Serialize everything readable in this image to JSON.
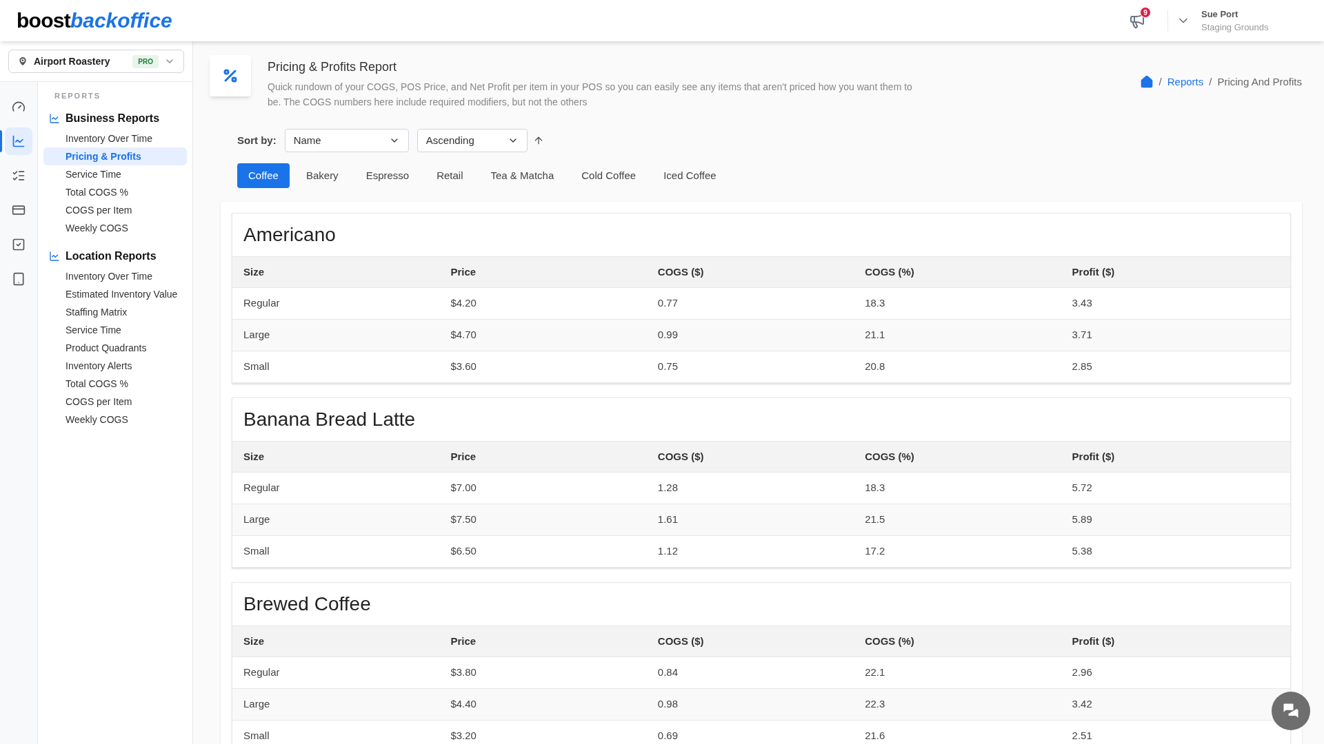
{
  "logo": {
    "part_1": "boost",
    "part_2": "backoffice"
  },
  "header": {
    "notification_count": "9",
    "user_name": "Sue Port",
    "user_location": "Staging Grounds"
  },
  "location_picker": {
    "name": "Airport Roastery",
    "badge": "PRO"
  },
  "rail": [
    {
      "kind": "gauge",
      "selected": false
    },
    {
      "kind": "chart",
      "selected": true
    },
    {
      "kind": "checklist",
      "selected": false
    },
    {
      "kind": "card",
      "selected": false
    },
    {
      "kind": "checkbox",
      "selected": false
    },
    {
      "kind": "tablet",
      "selected": false
    }
  ],
  "sidebar": {
    "section_label": "REPORTS",
    "groups": [
      {
        "title": "Business Reports",
        "items": [
          {
            "label": "Inventory Over Time",
            "selected": false
          },
          {
            "label": "Pricing & Profits",
            "selected": true
          },
          {
            "label": "Service Time",
            "selected": false
          },
          {
            "label": "Total COGS %",
            "selected": false
          },
          {
            "label": "COGS per Item",
            "selected": false
          },
          {
            "label": "Weekly COGS",
            "selected": false
          }
        ]
      },
      {
        "title": "Location Reports",
        "items": [
          {
            "label": "Inventory Over Time",
            "selected": false
          },
          {
            "label": "Estimated Inventory Value",
            "selected": false
          },
          {
            "label": "Staffing Matrix",
            "selected": false
          },
          {
            "label": "Service Time",
            "selected": false
          },
          {
            "label": "Product Quadrants",
            "selected": false
          },
          {
            "label": "Inventory Alerts",
            "selected": false
          },
          {
            "label": "Total COGS %",
            "selected": false
          },
          {
            "label": "COGS per Item",
            "selected": false
          },
          {
            "label": "Weekly COGS",
            "selected": false
          }
        ]
      }
    ]
  },
  "page": {
    "title": "Pricing & Profits Report",
    "description": "Quick rundown of your COGS, POS Price, and Net Profit per item in your POS so you can easily see any items that aren't priced how you want them to be. The COGS numbers here include required modifiers, but not the others"
  },
  "breadcrumb": [
    {
      "separator": "/",
      "label": "Reports",
      "kind": "link"
    },
    {
      "separator": "/",
      "label": "Pricing And Profits",
      "kind": "current"
    }
  ],
  "sort": {
    "label": "Sort by:",
    "field": "Name",
    "order": "Ascending"
  },
  "tabs": [
    {
      "label": "Coffee",
      "selected": true
    },
    {
      "label": "Bakery",
      "selected": false
    },
    {
      "label": "Espresso",
      "selected": false
    },
    {
      "label": "Retail",
      "selected": false
    },
    {
      "label": "Tea & Matcha",
      "selected": false
    },
    {
      "label": "Cold Coffee",
      "selected": false
    },
    {
      "label": "Iced Coffee",
      "selected": false
    }
  ],
  "products": [
    {
      "name": "Americano",
      "columns": [
        "Size",
        "Price",
        "COGS ($)",
        "COGS (%)",
        "Profit ($)"
      ],
      "rows": [
        [
          "Regular",
          "$4.20",
          "0.77",
          "18.3",
          "3.43"
        ],
        [
          "Large",
          "$4.70",
          "0.99",
          "21.1",
          "3.71"
        ],
        [
          "Small",
          "$3.60",
          "0.75",
          "20.8",
          "2.85"
        ]
      ]
    },
    {
      "name": "Banana Bread Latte",
      "columns": [
        "Size",
        "Price",
        "COGS ($)",
        "COGS (%)",
        "Profit ($)"
      ],
      "rows": [
        [
          "Regular",
          "$7.00",
          "1.28",
          "18.3",
          "5.72"
        ],
        [
          "Large",
          "$7.50",
          "1.61",
          "21.5",
          "5.89"
        ],
        [
          "Small",
          "$6.50",
          "1.12",
          "17.2",
          "5.38"
        ]
      ]
    },
    {
      "name": "Brewed Coffee",
      "columns": [
        "Size",
        "Price",
        "COGS ($)",
        "COGS (%)",
        "Profit ($)"
      ],
      "rows": [
        [
          "Regular",
          "$3.80",
          "0.84",
          "22.1",
          "2.96"
        ],
        [
          "Large",
          "$4.40",
          "0.98",
          "22.3",
          "3.42"
        ],
        [
          "Small",
          "$3.20",
          "0.69",
          "21.6",
          "2.51"
        ]
      ]
    }
  ]
}
